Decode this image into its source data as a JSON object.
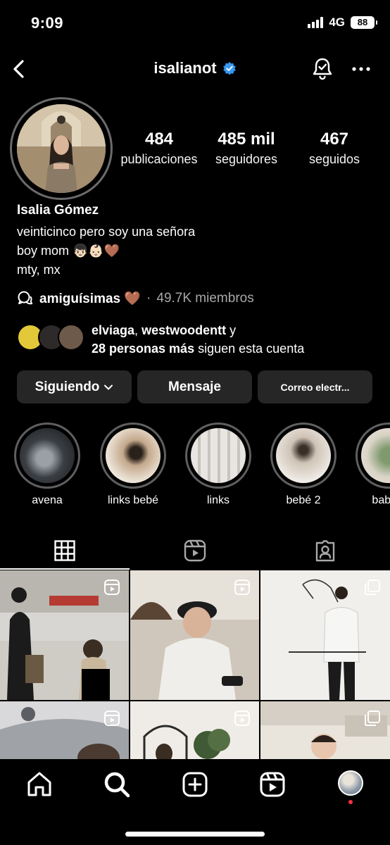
{
  "status_bar": {
    "time": "9:09",
    "network": "4G",
    "battery": "88"
  },
  "header": {
    "username": "isalianot"
  },
  "stats": [
    {
      "value": "484",
      "label": "publicaciones"
    },
    {
      "value": "485 mil",
      "label": "seguidores"
    },
    {
      "value": "467",
      "label": "seguidos"
    }
  ],
  "profile": {
    "name": "Isalia Gómez",
    "bio": [
      "veinticinco pero soy una señora",
      "boy mom 👦🏻👶🏻🤎",
      "mty, mx"
    ]
  },
  "community": {
    "name": "amiguísimas 🤎",
    "separator": "·",
    "members": "49.7K miembros"
  },
  "followed_by": {
    "user1": "elviaga",
    "comma": ",",
    "user2": "westwoodentt",
    "conj": "y",
    "others": "28 personas más",
    "suffix": "siguen esta cuenta"
  },
  "buttons": {
    "following": "Siguiendo",
    "message": "Mensaje",
    "email": "Correo electr..."
  },
  "highlights": [
    {
      "label": "avena"
    },
    {
      "label": "links bebé"
    },
    {
      "label": "links"
    },
    {
      "label": "bebé 2"
    },
    {
      "label": "baby s"
    }
  ],
  "tabs": [
    {
      "icon": "grid-icon",
      "selected": true
    },
    {
      "icon": "reels-icon",
      "selected": false
    },
    {
      "icon": "tagged-icon",
      "selected": false
    }
  ],
  "colors": {
    "background": "#000000",
    "button": "#262626",
    "verified": "#3897f0",
    "notification_dot": "#ff3040",
    "muted_text": "#a8a8a8"
  }
}
